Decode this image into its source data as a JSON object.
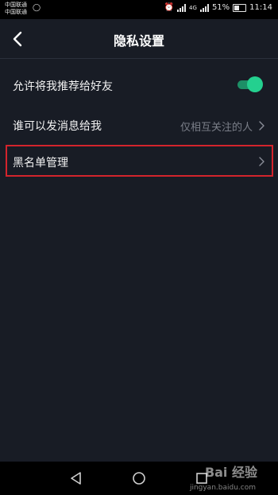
{
  "status_bar": {
    "carrier_line1": "中国联通",
    "carrier_line2": "中国联通",
    "network": "4G",
    "battery": "51%",
    "time": "11:14"
  },
  "header": {
    "title": "隐私设置"
  },
  "settings": {
    "recommend_label": "允许将我推荐给好友",
    "recommend_enabled": true,
    "message_label": "谁可以发消息给我",
    "message_value": "仅相互关注的人",
    "blacklist_label": "黑名单管理"
  },
  "watermark": {
    "brand": "Bai 经验",
    "url": "jingyan.baidu.com"
  },
  "colors": {
    "background": "#181c25",
    "toggle_on": "#24d08f",
    "highlight": "#d3242c"
  }
}
